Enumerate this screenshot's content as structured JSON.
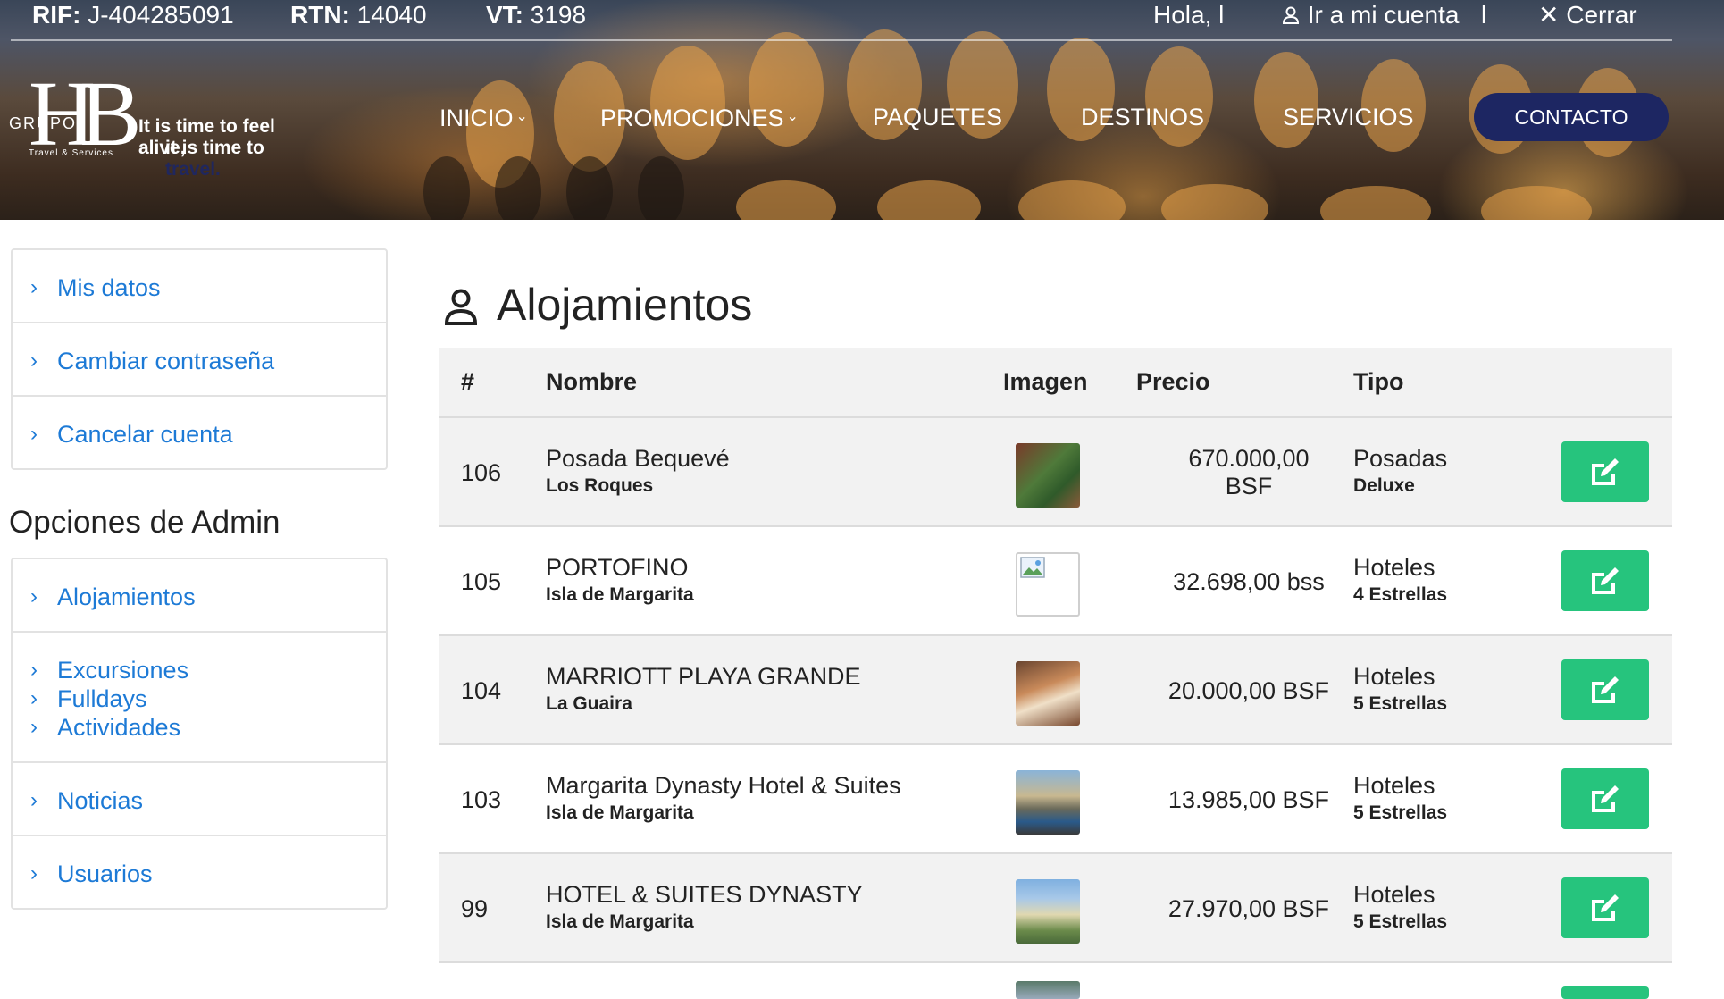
{
  "topbar": {
    "rif_label": "RIF:",
    "rif_value": "J-404285091",
    "rtn_label": "RTN:",
    "rtn_value": "14040",
    "vt_label": "VT:",
    "vt_value": "3198",
    "greeting": "Hola, l",
    "account_link": "Ir a mi cuenta",
    "separator": "l",
    "logout": "Cerrar"
  },
  "logo": {
    "letters": "HB",
    "grupo": "GRUPO",
    "sub": "Travel & Services",
    "tagline_1": "It is time to feel alive,",
    "tagline_2a": "it is time to ",
    "tagline_2b": "travel."
  },
  "nav": {
    "inicio": "INICIO",
    "promociones": "PROMOCIONES",
    "paquetes": "PAQUETES",
    "destinos": "DESTINOS",
    "servicios": "SERVICIOS",
    "contacto": "CONTACTO"
  },
  "account_menu": {
    "mis_datos": "Mis datos",
    "cambiar": "Cambiar contraseña",
    "cancelar": "Cancelar cuenta"
  },
  "admin": {
    "title": "Opciones de Admin",
    "alojamientos": "Alojamientos",
    "excursiones": "Excursiones",
    "fulldays": "Fulldays",
    "actividades": "Actividades",
    "noticias": "Noticias",
    "usuarios": "Usuarios"
  },
  "page": {
    "title": "Alojamientos"
  },
  "table": {
    "headers": {
      "num": "#",
      "nombre": "Nombre",
      "imagen": "Imagen",
      "precio": "Precio",
      "tipo": "Tipo"
    },
    "rows": [
      {
        "id": "106",
        "name": "Posada Bequevé",
        "location": "Los Roques",
        "price_1": "670.000,00",
        "price_2": "BSF",
        "type": "Posadas",
        "subtype": "Deluxe"
      },
      {
        "id": "105",
        "name": "PORTOFINO",
        "location": "Isla de Margarita",
        "price_1": "32.698,00 bss",
        "price_2": "",
        "type": "Hoteles",
        "subtype": "4 Estrellas"
      },
      {
        "id": "104",
        "name": "MARRIOTT PLAYA GRANDE",
        "location": "La Guaira",
        "price_1": "20.000,00 BSF",
        "price_2": "",
        "type": "Hoteles",
        "subtype": "5 Estrellas"
      },
      {
        "id": "103",
        "name": "Margarita Dynasty Hotel & Suites",
        "location": "Isla de Margarita",
        "price_1": "13.985,00 BSF",
        "price_2": "",
        "type": "Hoteles",
        "subtype": "5 Estrellas"
      },
      {
        "id": "99",
        "name": "HOTEL & SUITES DYNASTY",
        "location": "Isla de Margarita",
        "price_1": "27.970,00 BSF",
        "price_2": "",
        "type": "Hoteles",
        "subtype": "5 Estrellas"
      }
    ]
  },
  "colors": {
    "link": "#1d7ad6",
    "contact_bg": "#1d2662",
    "edit_btn": "#26c47d",
    "row_alt": "#f2f2f2"
  }
}
